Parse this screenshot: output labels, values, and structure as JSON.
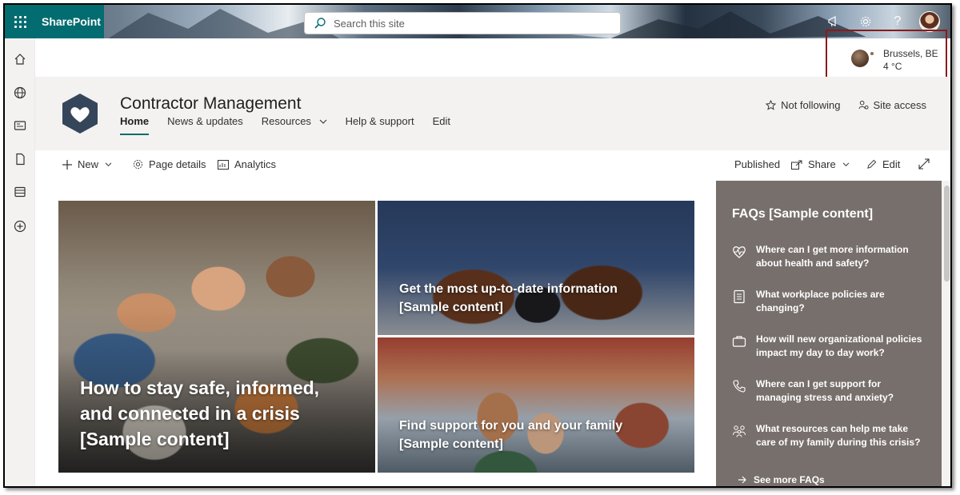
{
  "suite": {
    "app_name": "SharePoint",
    "search_placeholder": "Search this site"
  },
  "weather": {
    "city": "Brussels, BE",
    "temperature": "4 °C"
  },
  "site": {
    "title": "Contractor Management",
    "nav": [
      {
        "label": "Home",
        "active": true
      },
      {
        "label": "News & updates"
      },
      {
        "label": "Resources",
        "has_dropdown": true
      },
      {
        "label": "Help & support"
      },
      {
        "label": "Edit"
      }
    ],
    "follow_label": "Not following",
    "access_label": "Site access"
  },
  "commandbar": {
    "new_label": "New",
    "page_details_label": "Page details",
    "analytics_label": "Analytics",
    "published_label": "Published",
    "share_label": "Share",
    "edit_label": "Edit"
  },
  "hero": {
    "tile1": "How to stay safe, informed, and connected in a crisis [Sample content]",
    "tile2": "Get the most up-to-date information [Sample content]",
    "tile3": "Find support for you and your family [Sample content]"
  },
  "faq": {
    "title": "FAQs [Sample content]",
    "items": [
      {
        "icon": "heart-monitor-icon",
        "text": "Where can I get more information about health and safety?"
      },
      {
        "icon": "document-list-icon",
        "text": "What workplace policies are changing?"
      },
      {
        "icon": "briefcase-icon",
        "text": "How will new organizational policies impact my day to day work?"
      },
      {
        "icon": "phone-icon",
        "text": "Where can I get support for managing stress and anxiety?"
      },
      {
        "icon": "family-icon",
        "text": "What resources can help me take care of my family during this crisis?"
      }
    ],
    "see_more": "See more FAQs"
  },
  "colors": {
    "brand": "#036c70",
    "faq_panel": "#776f6b",
    "header_bg": "#f3f2f1",
    "highlight_box": "#8b1a1a"
  }
}
